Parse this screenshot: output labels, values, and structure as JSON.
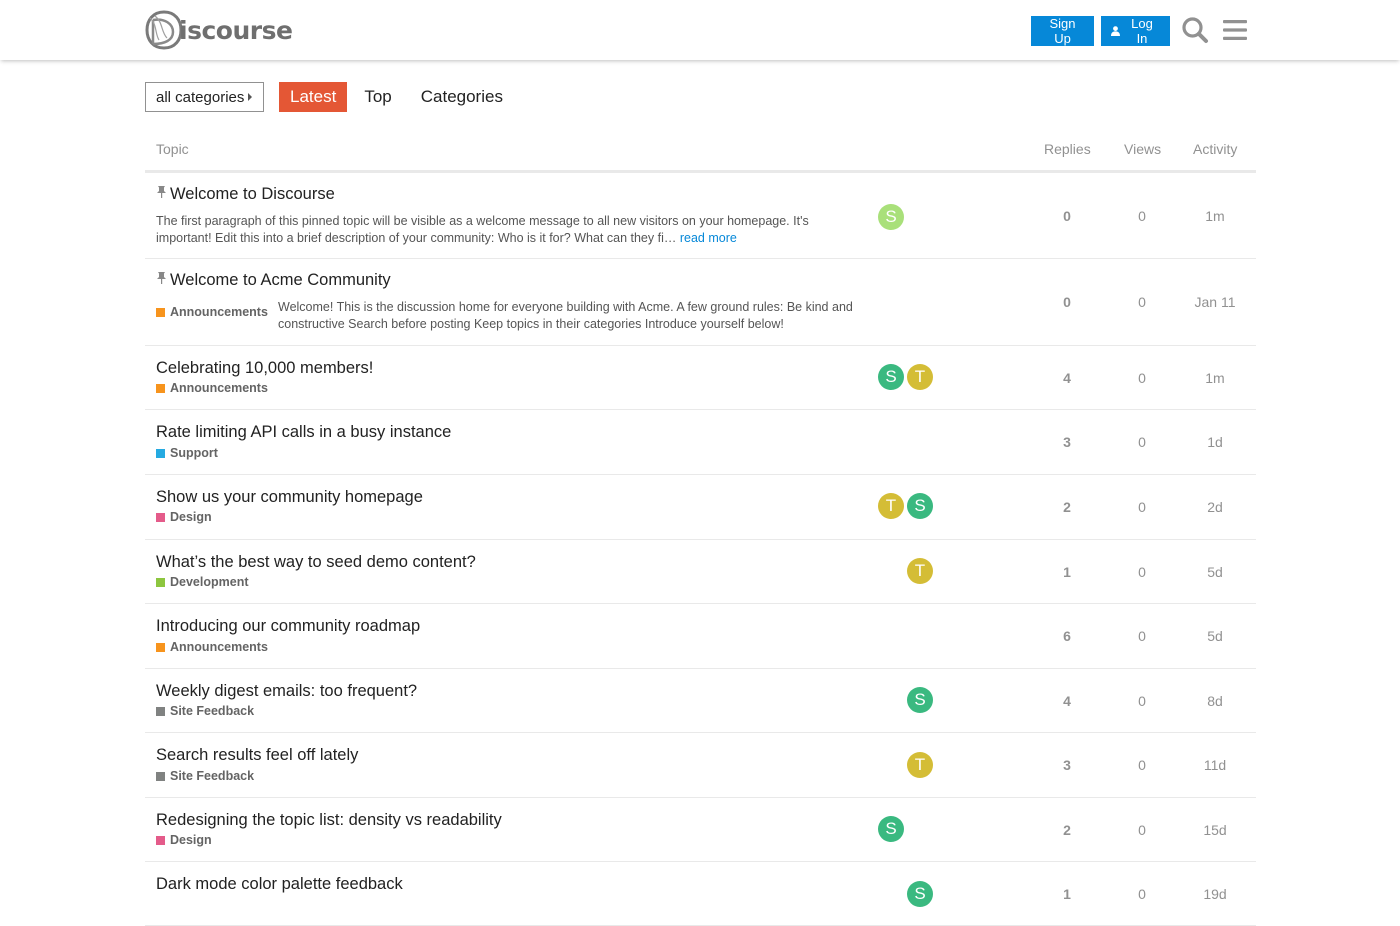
{
  "header": {
    "logo_text": "iscourse",
    "signup_label": "Sign Up",
    "login_label": "Log In"
  },
  "nav": {
    "category_dropdown": "all categories",
    "tabs": [
      "Latest",
      "Top",
      "Categories"
    ],
    "active_tab": "Latest"
  },
  "table": {
    "headers": {
      "topic": "Topic",
      "replies": "Replies",
      "views": "Views",
      "activity": "Activity"
    },
    "rows": [
      {
        "title": "Welcome to Discourse",
        "pinned": true,
        "excerpt": "The first paragraph of this pinned topic will be visible as a welcome message to all new visitors on your homepage. It's important! Edit this into a brief description of your community: Who is it for? What can they fi…",
        "read_more": "read more",
        "category": "",
        "posters": [
          "S"
        ],
        "replies": "0",
        "views": "0",
        "activity": "1m"
      },
      {
        "title": "Welcome to Acme Community",
        "pinned": true,
        "excerpt": "Welcome! This is the discussion home for everyone building with Acme. A few ground rules: Be kind and constructive Search before posting Keep topics in their categories Introduce yourself below!",
        "category": "Announcements",
        "posters": [],
        "replies": "0",
        "views": "0",
        "activity": "Jan 11"
      },
      {
        "title": "Celebrating 10,000 members!",
        "category": "Announcements",
        "posters": [
          "S",
          "T"
        ],
        "replies": "4",
        "views": "0",
        "activity": "1m"
      },
      {
        "title": "Rate limiting API calls in a busy instance",
        "category": "Support",
        "posters": [],
        "replies": "3",
        "views": "0",
        "activity": "1d"
      },
      {
        "title": "Show us your community homepage",
        "category": "Design",
        "posters": [
          "T",
          "S"
        ],
        "replies": "2",
        "views": "0",
        "activity": "2d"
      },
      {
        "title": "What’s the best way to seed demo content?",
        "category": "Development",
        "posters": [
          "T"
        ],
        "replies": "1",
        "views": "0",
        "activity": "5d"
      },
      {
        "title": "Introducing our community roadmap",
        "category": "Announcements",
        "posters": [],
        "replies": "6",
        "views": "0",
        "activity": "5d"
      },
      {
        "title": "Weekly digest emails: too frequent?",
        "category": "Site Feedback",
        "posters": [
          "S"
        ],
        "replies": "4",
        "views": "0",
        "activity": "8d"
      },
      {
        "title": "Search results feel off lately",
        "category": "Site Feedback",
        "posters": [
          "T"
        ],
        "replies": "3",
        "views": "0",
        "activity": "11d"
      },
      {
        "title": "Redesigning the topic list: density vs readability",
        "category": "Design",
        "posters": [
          "S"
        ],
        "replies": "2",
        "views": "0",
        "activity": "15d"
      },
      {
        "title": "Dark mode color palette feedback",
        "category": "",
        "posters": [
          "S"
        ],
        "replies": "1",
        "views": "0",
        "activity": "19d"
      }
    ]
  },
  "category_colors": {
    "Announcements": "#f7941d",
    "Support": "#25aae1",
    "Design": "#e45b8a",
    "Development": "#8dc63f",
    "Site Feedback": "#808281"
  },
  "avatar_colors": {
    "S": "#3ab980",
    "S_light": "#a9e07a",
    "T": "#d4bd36"
  }
}
